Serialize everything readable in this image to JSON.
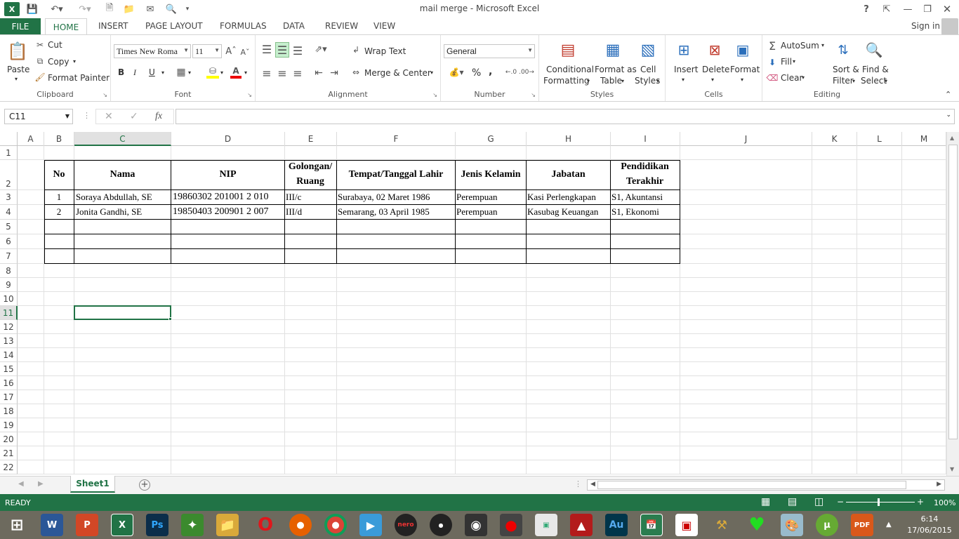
{
  "window": {
    "title": "mail merge - Microsoft Excel",
    "sign_in": "Sign in",
    "help": "?"
  },
  "tabs": [
    "FILE",
    "HOME",
    "INSERT",
    "PAGE LAYOUT",
    "FORMULAS",
    "DATA",
    "REVIEW",
    "VIEW"
  ],
  "ribbon": {
    "clipboard": {
      "paste": "Paste",
      "cut": "Cut",
      "copy": "Copy",
      "format_painter": "Format Painter",
      "group": "Clipboard"
    },
    "font": {
      "name": "Times New Roma",
      "size": "11",
      "bold": "B",
      "italic": "I",
      "underline": "U",
      "group": "Font"
    },
    "alignment": {
      "wrap": "Wrap Text",
      "merge": "Merge & Center",
      "group": "Alignment"
    },
    "number": {
      "format": "General",
      "percent": "%",
      "comma": ",",
      "group": "Number"
    },
    "styles": {
      "cond1": "Conditional",
      "cond2": "Formatting",
      "fmt1": "Format as",
      "fmt2": "Table",
      "cell1": "Cell",
      "cell2": "Styles",
      "group": "Styles"
    },
    "cells": {
      "insert": "Insert",
      "delete": "Delete",
      "format": "Format",
      "group": "Cells"
    },
    "editing": {
      "autosum": "AutoSum",
      "fill": "Fill",
      "clear": "Clear",
      "sort1": "Sort &",
      "sort2": "Filter",
      "find1": "Find &",
      "find2": "Select",
      "group": "Editing"
    }
  },
  "formula_bar": {
    "name_box": "C11",
    "fx": "fx",
    "value": ""
  },
  "columns": [
    "A",
    "B",
    "C",
    "D",
    "E",
    "F",
    "G",
    "H",
    "I",
    "J",
    "K",
    "L",
    "M"
  ],
  "rows": [
    "1",
    "2",
    "3",
    "4",
    "5",
    "6",
    "7",
    "8",
    "9",
    "10",
    "11",
    "12",
    "13",
    "14",
    "15",
    "16",
    "17",
    "18",
    "19",
    "20",
    "21",
    "22"
  ],
  "table": {
    "headers": {
      "no": "No",
      "nama": "Nama",
      "nip": "NIP",
      "gol1": "Golongan/",
      "gol2": "Ruang",
      "ttl": "Tempat/Tanggal Lahir",
      "jk": "Jenis Kelamin",
      "jab": "Jabatan",
      "pend1": "Pendidikan",
      "pend2": "Terakhir"
    },
    "rows": [
      {
        "no": "1",
        "nama": "Soraya Abdullah, SE",
        "nip": "19860302 201001 2 010",
        "gol": "III/c",
        "ttl": "Surabaya, 02 Maret 1986",
        "jk": "Perempuan",
        "jab": "Kasi Perlengkapan",
        "pend": "S1, Akuntansi"
      },
      {
        "no": "2",
        "nama": "Jonita Gandhi, SE",
        "nip": "19850403 200901 2 007",
        "gol": "III/d",
        "ttl": "Semarang, 03 April 1985",
        "jk": "Perempuan",
        "jab": "Kasubag Keuangan",
        "pend": "S1, Ekonomi"
      }
    ]
  },
  "sheet": {
    "tab": "Sheet1",
    "add": "+"
  },
  "status": {
    "ready": "READY",
    "zoom": "100%"
  },
  "taskbar": {
    "time": "6:14",
    "date": "17/06/2015",
    "apps": [
      "W",
      "P",
      "X",
      "Ps",
      "O",
      "Au",
      "PDF"
    ]
  },
  "colors": {
    "accent": "#217346",
    "selection": "#217346"
  }
}
